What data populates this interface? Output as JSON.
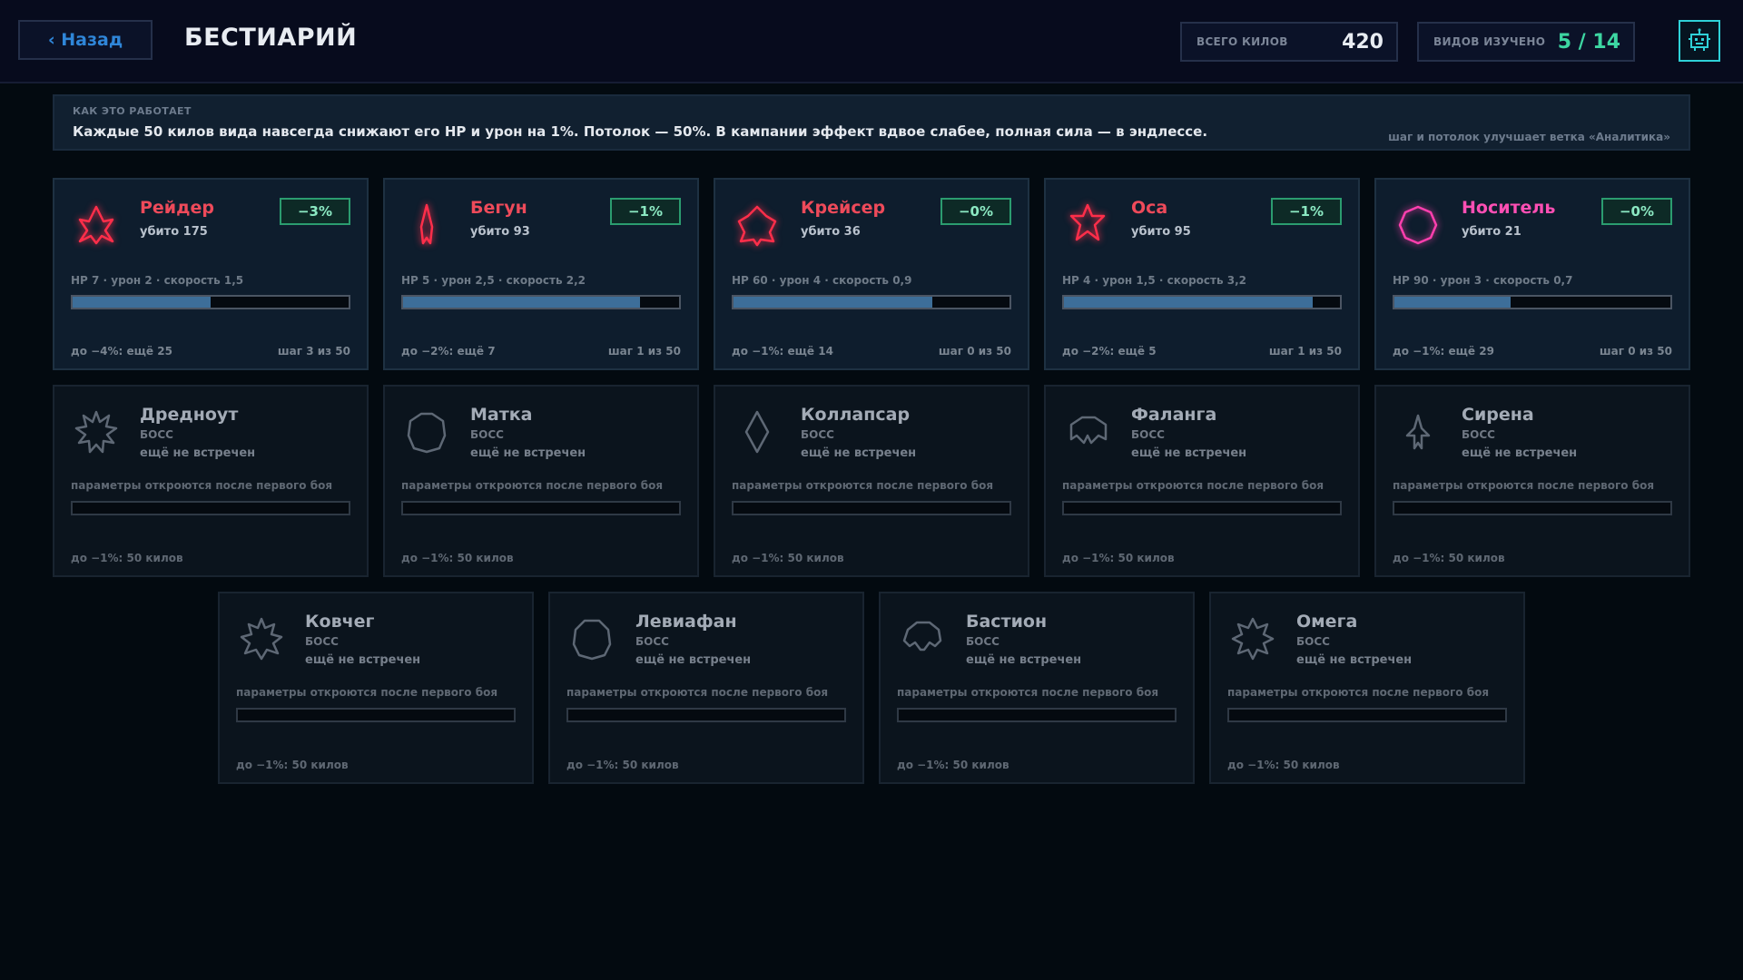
{
  "header": {
    "back_label": "‹ Назад",
    "title": "БЕСТИАРИЙ",
    "total_kills_label": "ВСЕГО КИЛОВ",
    "total_kills_value": "420",
    "species_label": "ВИДОВ ИЗУЧЕНО",
    "species_value": "5 / 14",
    "profile_icon": "robot-icon"
  },
  "info": {
    "kicker": "КАК ЭТО РАБОТАЕТ",
    "text": "Каждые 50 килов вида навсегда снижают его HP и урон на 1%. Потолок — 50%. В кампании эффект вдвое слабее, полная сила — в эндлессе.",
    "hint": "шаг и потолок улучшает ветка «Аналитика»"
  },
  "enemies": [
    {
      "name": "Рейдер",
      "kills": "убито 175",
      "badge": "−3%",
      "stats": "HP 7 · урон 2 · скорость 1,5",
      "progress": 0.5,
      "foot_left": "до −4%: ещё 25",
      "foot_right": "шаг 3 из 50",
      "color": "#ff2e4a",
      "icon": "raider-ship-icon"
    },
    {
      "name": "Бегун",
      "kills": "убито 93",
      "badge": "−1%",
      "stats": "HP 5 · урон 2,5 · скорость 2,2",
      "progress": 0.86,
      "foot_left": "до −2%: ещё 7",
      "foot_right": "шаг 1 из 50",
      "color": "#ff2e4a",
      "icon": "runner-ship-icon"
    },
    {
      "name": "Крейсер",
      "kills": "убито 36",
      "badge": "−0%",
      "stats": "HP 60 · урон 4 · скорость 0,9",
      "progress": 0.72,
      "foot_left": "до −1%: ещё 14",
      "foot_right": "шаг 0 из 50",
      "color": "#ff2e4a",
      "icon": "cruiser-ship-icon"
    },
    {
      "name": "Оса",
      "kills": "убито 95",
      "badge": "−1%",
      "stats": "HP 4 · урон 1,5 · скорость 3,2",
      "progress": 0.9,
      "foot_left": "до −2%: ещё 5",
      "foot_right": "шаг 1 из 50",
      "color": "#ff2e4a",
      "icon": "wasp-ship-icon"
    },
    {
      "name": "Носитель",
      "kills": "убито 21",
      "badge": "−0%",
      "stats": "HP 90 · урон 3 · скорость 0,7",
      "progress": 0.42,
      "foot_left": "до −1%: ещё 29",
      "foot_right": "шаг 0 из 50",
      "color": "#ff3fae",
      "icon": "carrier-ship-icon"
    }
  ],
  "bosses": [
    {
      "name": "Дредноут",
      "icon": "dreadnought-icon"
    },
    {
      "name": "Матка",
      "icon": "hive-queen-icon"
    },
    {
      "name": "Коллапсар",
      "icon": "collapsar-icon"
    },
    {
      "name": "Фаланга",
      "icon": "phalanx-icon"
    },
    {
      "name": "Сирена",
      "icon": "siren-icon"
    },
    {
      "name": "Ковчег",
      "icon": "ark-icon"
    },
    {
      "name": "Левиафан",
      "icon": "leviathan-icon"
    },
    {
      "name": "Бастион",
      "icon": "bastion-icon"
    },
    {
      "name": "Омега",
      "icon": "omega-icon"
    }
  ],
  "locked_text": {
    "boss_label": "БОСС",
    "unseen": "ещё не встречен",
    "stats": "параметры откроются после первого боя",
    "foot": "до −1%: 50 килов"
  }
}
